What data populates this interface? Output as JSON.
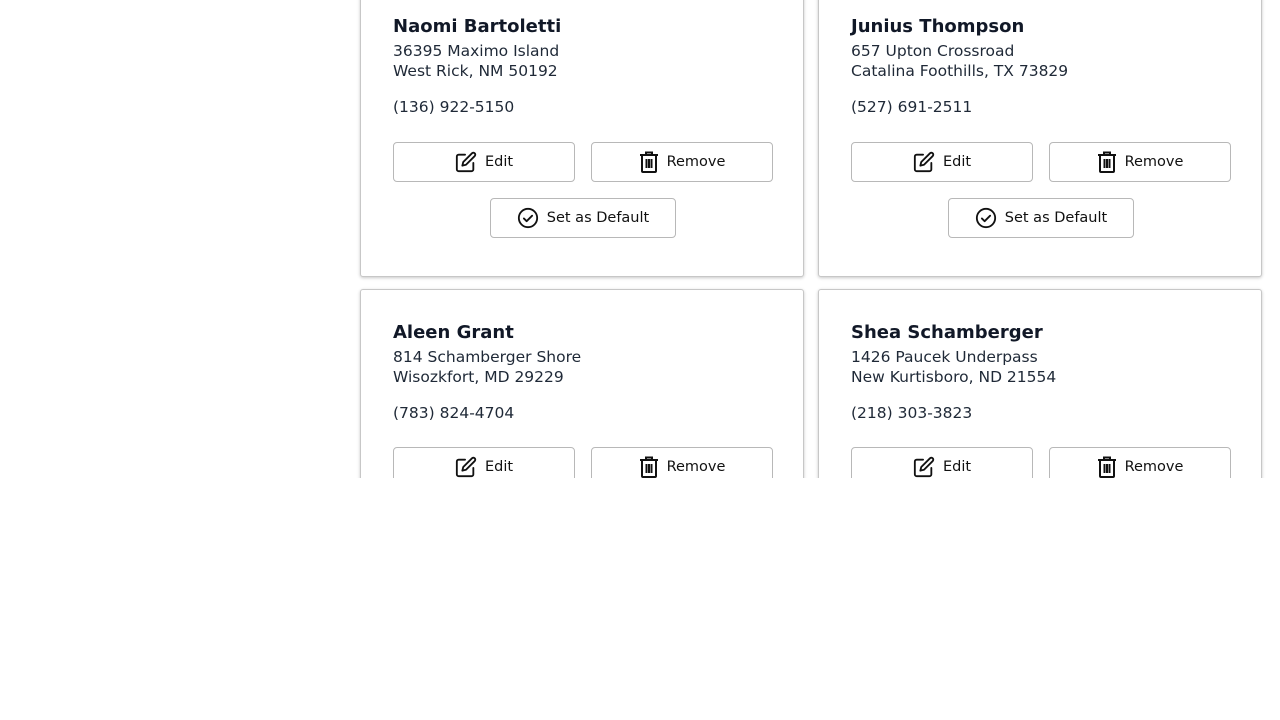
{
  "addresses": [
    {
      "name": "Naomi Bartoletti",
      "line1": "36395 Maximo Island",
      "line2": "West Rick, NM 50192",
      "phone": "(136) 922-5150",
      "edit_label": "Edit",
      "remove_label": "Remove",
      "default_label": "Set as Default"
    },
    {
      "name": "Junius Thompson",
      "line1": "657 Upton Crossroad",
      "line2": "Catalina Foothills, TX 73829",
      "phone": "(527) 691-2511",
      "edit_label": "Edit",
      "remove_label": "Remove",
      "default_label": "Set as Default"
    },
    {
      "name": "Aleen Grant",
      "line1": "814 Schamberger Shore",
      "line2": "Wisozkfort, MD 29229",
      "phone": "(783) 824-4704",
      "edit_label": "Edit",
      "remove_label": "Remove"
    },
    {
      "name": "Shea Schamberger",
      "line1": "1426 Paucek Underpass",
      "line2": "New Kurtisboro, ND 21554",
      "phone": "(218) 303-3823",
      "edit_label": "Edit",
      "remove_label": "Remove"
    }
  ],
  "icons": {
    "edit": "edit-icon",
    "remove": "trash-icon",
    "default": "check-circle-icon"
  }
}
